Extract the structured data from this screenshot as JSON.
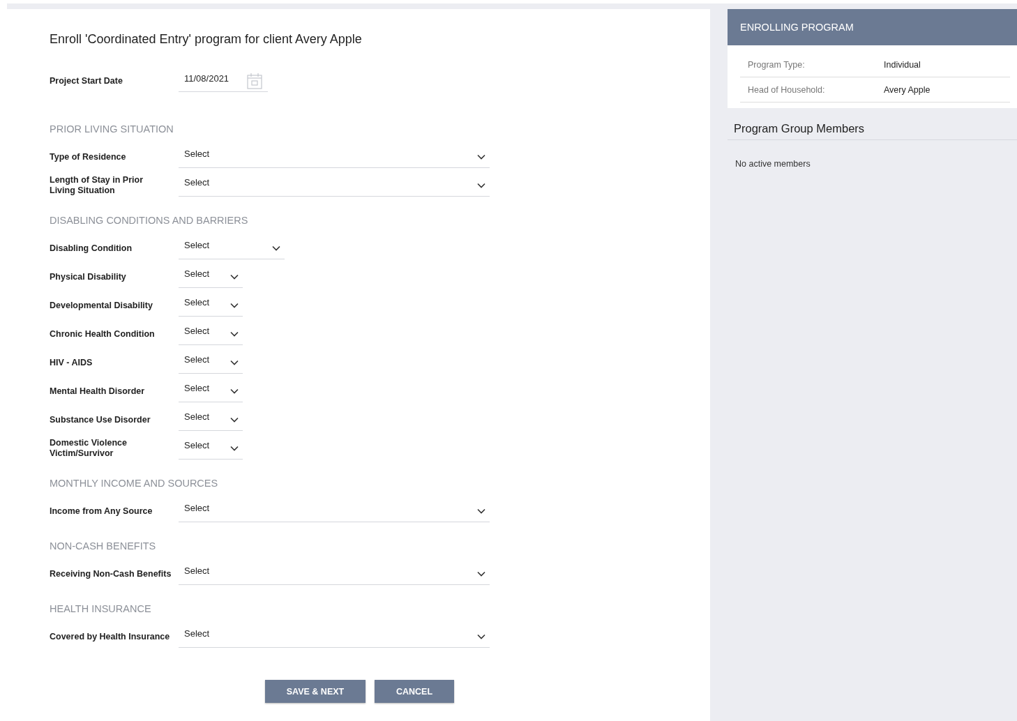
{
  "title": "Enroll 'Coordinated Entry' program for client Avery Apple",
  "start_date": {
    "label": "Project Start Date",
    "value": "11/08/2021"
  },
  "sections": [
    {
      "heading": "PRIOR LIVING SITUATION",
      "fields": [
        {
          "label": "Type of Residence",
          "value": "Select",
          "kind": "wide"
        },
        {
          "label": "Length of Stay in Prior Living Situation",
          "value": "Select",
          "kind": "wide"
        }
      ]
    },
    {
      "heading": "DISABLING CONDITIONS AND BARRIERS",
      "fields": [
        {
          "label": "Disabling Condition",
          "value": "Select",
          "kind": "medium"
        },
        {
          "label": "Physical Disability",
          "value": "Select",
          "kind": "narrow"
        },
        {
          "label": "Developmental Disability",
          "value": "Select",
          "kind": "narrow"
        },
        {
          "label": "Chronic Health Condition",
          "value": "Select",
          "kind": "narrow"
        },
        {
          "label": "HIV - AIDS",
          "value": "Select",
          "kind": "narrow"
        },
        {
          "label": "Mental Health Disorder",
          "value": "Select",
          "kind": "narrow"
        },
        {
          "label": "Substance Use Disorder",
          "value": "Select",
          "kind": "narrow"
        },
        {
          "label": "Domestic Violence Victim/Survivor",
          "value": "Select",
          "kind": "narrow"
        }
      ]
    },
    {
      "heading": "MONTHLY INCOME AND SOURCES",
      "fields": [
        {
          "label": "Income from Any Source",
          "value": "Select",
          "kind": "wide"
        }
      ]
    },
    {
      "heading": "NON-CASH BENEFITS",
      "fields": [
        {
          "label": "Receiving Non-Cash Benefits",
          "value": "Select",
          "kind": "wide"
        }
      ]
    },
    {
      "heading": "HEALTH INSURANCE",
      "fields": [
        {
          "label": "Covered by Health Insurance",
          "value": "Select",
          "kind": "wide"
        }
      ]
    }
  ],
  "buttons": [
    "SAVE & NEXT",
    "CANCEL"
  ],
  "side_panel": {
    "header": "ENROLLING PROGRAM",
    "details": [
      {
        "label": "Program Type:",
        "value": "Individual"
      },
      {
        "label": "Head of Household:",
        "value": "Avery Apple"
      }
    ],
    "members_title": "Program Group Members",
    "members_empty": "No active members"
  }
}
